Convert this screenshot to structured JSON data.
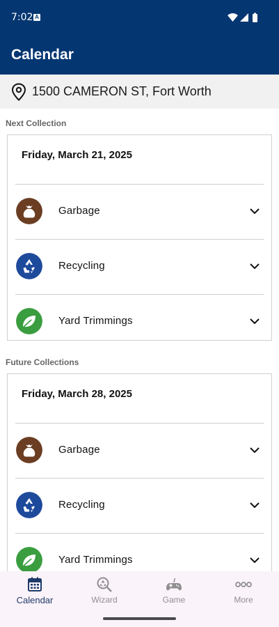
{
  "status": {
    "time": "7:02",
    "badge": "A"
  },
  "header": {
    "title": "Calendar"
  },
  "address": {
    "text": "1500 CAMERON ST, Fort Worth"
  },
  "sections": {
    "next": {
      "label": "Next Collection",
      "date": "Friday, March 21, 2025",
      "items": [
        {
          "label": "Garbage",
          "color": "#6b3d22"
        },
        {
          "label": "Recycling",
          "color": "#1e4a9c"
        },
        {
          "label": "Yard Trimmings",
          "color": "#3a9d3f"
        }
      ]
    },
    "future": {
      "label": "Future Collections",
      "date": "Friday, March 28, 2025",
      "items": [
        {
          "label": "Garbage",
          "color": "#6b3d22"
        },
        {
          "label": "Recycling",
          "color": "#1e4a9c"
        },
        {
          "label": "Yard Trimmings",
          "color": "#3a9d3f"
        }
      ]
    }
  },
  "nav": {
    "items": [
      {
        "label": "Calendar",
        "icon": "calendar-icon",
        "active": true
      },
      {
        "label": "Wizard",
        "icon": "wizard-search-icon",
        "active": false
      },
      {
        "label": "Game",
        "icon": "gamepad-icon",
        "active": false
      },
      {
        "label": "More",
        "icon": "more-dots-icon",
        "active": false
      }
    ]
  },
  "colors": {
    "primary": "#043671",
    "address_bg": "#f1f1f1",
    "nav_bg": "#fbf3fa"
  }
}
